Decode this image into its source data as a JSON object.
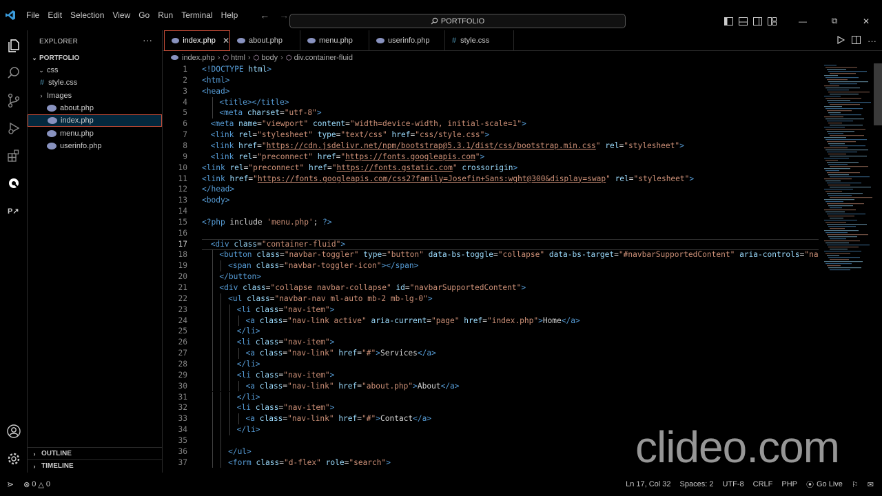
{
  "menubar": [
    "File",
    "Edit",
    "Selection",
    "View",
    "Go",
    "Run",
    "Terminal",
    "Help"
  ],
  "search": {
    "text": "PORTFOLIO"
  },
  "sidebar": {
    "title": "EXPLORER",
    "root": "PORTFOLIO",
    "items": [
      {
        "label": "css",
        "kind": "folder-open"
      },
      {
        "label": "style.css",
        "kind": "css"
      },
      {
        "label": "Images",
        "kind": "folder-closed"
      },
      {
        "label": "about.php",
        "kind": "php"
      },
      {
        "label": "index.php",
        "kind": "php"
      },
      {
        "label": "menu.php",
        "kind": "php"
      },
      {
        "label": "userinfo.php",
        "kind": "php"
      }
    ],
    "outline": "OUTLINE",
    "timeline": "TIMELINE"
  },
  "tabs": [
    "index.php",
    "about.php",
    "menu.php",
    "userinfo.php",
    "style.css"
  ],
  "breadcrumb": [
    "index.php",
    "html",
    "body",
    "div.container-fluid"
  ],
  "editor": {
    "current_line": 17,
    "lines": [
      {
        "n": "1",
        "i": 0,
        "code": "<!DOCTYPE html>"
      },
      {
        "n": "2",
        "i": 0,
        "code": "<html>"
      },
      {
        "n": "3",
        "i": 0,
        "code": "<head>"
      },
      {
        "n": "4",
        "i": 2,
        "code": "<title></title>"
      },
      {
        "n": "5",
        "i": 2,
        "code": "<meta charset=\"utf-8\">"
      },
      {
        "n": "6",
        "i": 1,
        "code": "<meta name=\"viewport\" content=\"width=device-width, initial-scale=1\">"
      },
      {
        "n": "7",
        "i": 1,
        "code": "<link rel=\"stylesheet\" type=\"text/css\" href=\"css/style.css\">"
      },
      {
        "n": "8",
        "i": 1,
        "code": "<link href=\"https://cdn.jsdelivr.net/npm/bootstrap@5.3.1/dist/css/bootstrap.min.css\" rel=\"stylesheet\">"
      },
      {
        "n": "9",
        "i": 1,
        "code": "<link rel=\"preconnect\" href=\"https://fonts.googleapis.com\">"
      },
      {
        "n": "10",
        "i": 0,
        "code": "<link rel=\"preconnect\" href=\"https://fonts.gstatic.com\" crossorigin>"
      },
      {
        "n": "11",
        "i": 0,
        "code": "<link href=\"https://fonts.googleapis.com/css2?family=Josefin+Sans:wght@300&display=swap\" rel=\"stylesheet\">"
      },
      {
        "n": "12",
        "i": 0,
        "code": "</head>"
      },
      {
        "n": "13",
        "i": 0,
        "code": "<body>"
      },
      {
        "n": "14",
        "i": 0,
        "code": ""
      },
      {
        "n": "15",
        "i": 0,
        "code": "<?php include 'menu.php'; ?>"
      },
      {
        "n": "16",
        "i": 0,
        "code": ""
      },
      {
        "n": "17",
        "i": 1,
        "code": "<div class=\"container-fluid\">"
      },
      {
        "n": "18",
        "i": 2,
        "code": "<button class=\"navbar-toggler\" type=\"button\" data-bs-toggle=\"collapse\" data-bs-target=\"#navbarSupportedContent\" aria-controls=\"navbarSup"
      },
      {
        "n": "19",
        "i": 3,
        "code": "<span class=\"navbar-toggler-icon\"></span>"
      },
      {
        "n": "20",
        "i": 2,
        "code": "</button>"
      },
      {
        "n": "21",
        "i": 2,
        "code": "<div class=\"collapse navbar-collapse\" id=\"navbarSupportedContent\">"
      },
      {
        "n": "22",
        "i": 3,
        "code": "<ul class=\"navbar-nav ml-auto mb-2 mb-lg-0\">"
      },
      {
        "n": "23",
        "i": 4,
        "code": "<li class=\"nav-item\">"
      },
      {
        "n": "24",
        "i": 5,
        "code": "<a class=\"nav-link active\" aria-current=\"page\" href=\"index.php\">Home</a>"
      },
      {
        "n": "25",
        "i": 4,
        "code": "</li>"
      },
      {
        "n": "26",
        "i": 4,
        "code": "<li class=\"nav-item\">"
      },
      {
        "n": "27",
        "i": 5,
        "code": "<a class=\"nav-link\" href=\"#\">Services</a>"
      },
      {
        "n": "28",
        "i": 4,
        "code": "</li>"
      },
      {
        "n": "29",
        "i": 4,
        "code": "<li class=\"nav-item\">"
      },
      {
        "n": "30",
        "i": 5,
        "code": "<a class=\"nav-link\" href=\"about.php\">About</a>"
      },
      {
        "n": "31",
        "i": 4,
        "code": "</li>"
      },
      {
        "n": "32",
        "i": 4,
        "code": "<li class=\"nav-item\">"
      },
      {
        "n": "33",
        "i": 5,
        "code": "<a class=\"nav-link\" href=\"#\">Contact</a>"
      },
      {
        "n": "34",
        "i": 4,
        "code": "</li>"
      },
      {
        "n": "35",
        "i": 3,
        "code": ""
      },
      {
        "n": "36",
        "i": 3,
        "code": "</ul>"
      },
      {
        "n": "37",
        "i": 3,
        "code": "<form class=\"d-flex\" role=\"search\">"
      }
    ]
  },
  "watermark": "clideo.com",
  "status": {
    "errors": "0",
    "warnings": "0",
    "position": "Ln 17, Col 32",
    "spaces": "Spaces: 2",
    "encoding": "UTF-8",
    "eol": "CRLF",
    "language": "PHP",
    "golive": "Go Live"
  },
  "colors": {
    "accent": "#c74e39",
    "tag": "#569cd6",
    "attr": "#9cdcfe",
    "string": "#ce9178"
  }
}
